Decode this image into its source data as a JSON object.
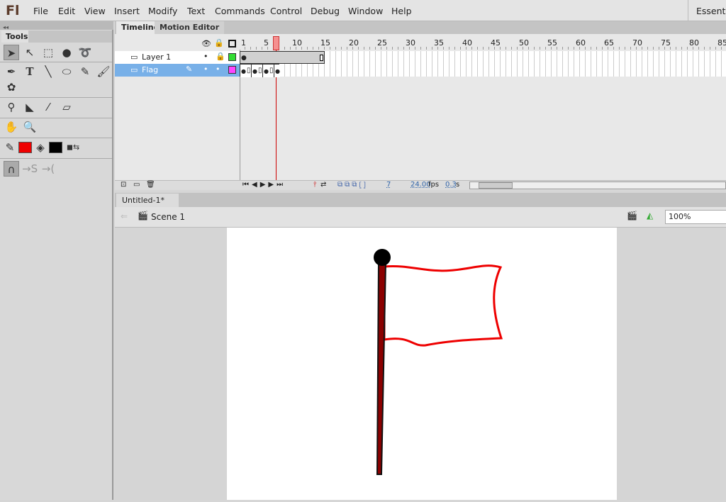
{
  "app": {
    "logo": "Fl",
    "workspace": "Essenti"
  },
  "menu": [
    "File",
    "Edit",
    "View",
    "Insert",
    "Modify",
    "Text",
    "Commands",
    "Control",
    "Debug",
    "Window",
    "Help"
  ],
  "tools": {
    "title": "Tools"
  },
  "timeline": {
    "tabs": [
      "Timeline",
      "Motion Editor"
    ],
    "ruler": [
      "1",
      "5",
      "10",
      "15",
      "20",
      "25",
      "30",
      "35",
      "40",
      "45",
      "50",
      "55",
      "60",
      "65",
      "70",
      "75",
      "80",
      "85"
    ],
    "layers": [
      {
        "name": "Layer 1",
        "color": "#33dd33",
        "selected": false
      },
      {
        "name": "Flag",
        "color": "#ff44ff",
        "selected": true
      }
    ],
    "current_frame": "7",
    "fps": "24.00",
    "fps_unit": "fps",
    "time": "0.3",
    "time_unit": "s"
  },
  "document": {
    "tab": "Untitled-1*",
    "close": "×",
    "scene": "Scene 1",
    "zoom": "100%"
  },
  "colors": {
    "stroke": "#ee0000",
    "fill": "#000000",
    "selection": "#78b0e8",
    "playhead": "#cc0000"
  }
}
